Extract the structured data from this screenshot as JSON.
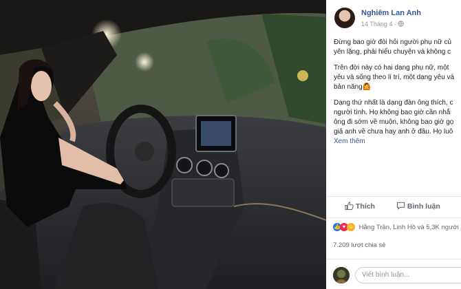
{
  "post": {
    "author": "Nghiêm Lan Anh",
    "date": "14 Tháng 4 ·",
    "body_lines": [
      [
        "Đừng bao giờ đòi hỏi người phụ nữ củ",
        "yên lặng, phải hiểu chuyện và không c"
      ],
      [
        "Trên đời này có hai dạng phụ nữ, một",
        "yêu và sống theo lí trí, một dạng yêu và",
        "bản năng🙆"
      ],
      [
        "Dạng thứ nhất là dạng đàn ông thích, c",
        "người tình. Họ không bao giờ cần nhắ",
        "ông đi sớm về muộn, không bao giờ gọ",
        "giã anh về chưa hay anh ở đâu. Họ luô"
      ]
    ],
    "see_more": "Xem thêm"
  },
  "actions": {
    "like": "Thích",
    "comment": "Bình luận"
  },
  "reactions": {
    "text": "Hằng Trần, Linh Hồ và 5,3K người k",
    "icons": [
      "like-reaction",
      "love-reaction",
      "haha-reaction"
    ]
  },
  "shares": "7.209 lượt chia sẻ",
  "comment_box": {
    "placeholder": "Viết bình luận..."
  },
  "colors": {
    "link": "#365899",
    "like_blue": "#1877f2",
    "love_red": "#f0284a",
    "haha_yellow": "#f7b125"
  }
}
